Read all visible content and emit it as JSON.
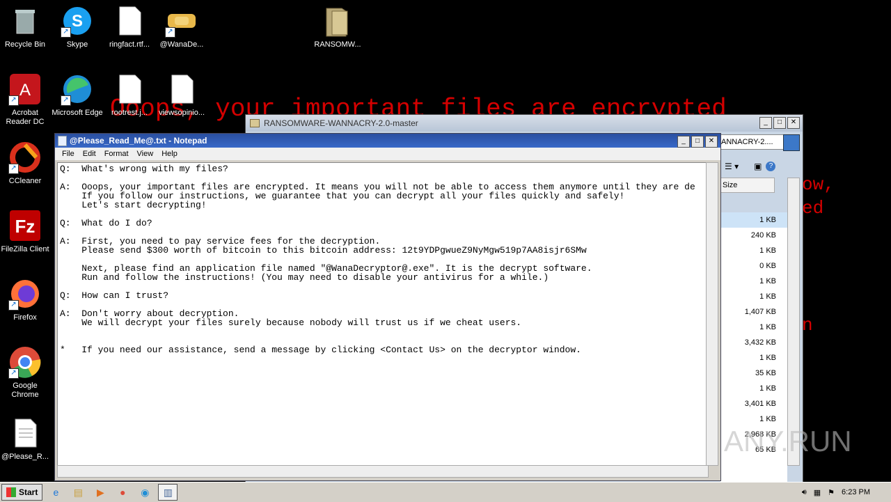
{
  "desktop": {
    "icons": [
      {
        "label": "Recycle Bin",
        "icon": "recycle-bin-icon"
      },
      {
        "label": "Skype",
        "icon": "skype-icon"
      },
      {
        "label": "ringfact.rtf...",
        "icon": "document-icon"
      },
      {
        "label": "@WanaDe...",
        "icon": "handshake-icon"
      },
      {
        "label": "RANSOMW...",
        "icon": "folder-icon"
      },
      {
        "label": "Acrobat Reader DC",
        "icon": "acrobat-icon"
      },
      {
        "label": "Microsoft Edge",
        "icon": "edge-icon"
      },
      {
        "label": "rootrest.j...",
        "icon": "document-icon"
      },
      {
        "label": "viewsopinio...",
        "icon": "document-icon"
      },
      {
        "label": "CCleaner",
        "icon": "ccleaner-icon"
      },
      {
        "label": "FileZilla Client",
        "icon": "filezilla-icon"
      },
      {
        "label": "Firefox",
        "icon": "firefox-icon"
      },
      {
        "label": "Google Chrome",
        "icon": "chrome-icon"
      },
      {
        "label": "@Please_R...",
        "icon": "text-file-icon"
      }
    ],
    "wallpaper_lines": [
      "Ooops, your important files are encrypted",
      "ow,",
      "ed",
      "n"
    ]
  },
  "explorer": {
    "title": "RANSOMWARE-WANNACRY-2.0-master",
    "address": "ANNACRY-2....",
    "column_header": "Size",
    "sizes": [
      "1 KB",
      "240 KB",
      "1 KB",
      "0 KB",
      "1 KB",
      "1 KB",
      "1,407 KB",
      "1 KB",
      "3,432 KB",
      "1 KB",
      "35 KB",
      "1 KB",
      "3,401 KB",
      "1 KB",
      "2,968 KB",
      "65 KB"
    ]
  },
  "notepad": {
    "title": "@Please_Read_Me@.txt - Notepad",
    "menu": [
      "File",
      "Edit",
      "Format",
      "View",
      "Help"
    ],
    "body": "Q:  What's wrong with my files?\n\nA:  Ooops, your important files are encrypted. It means you will not be able to access them anymore until they are de\n    If you follow our instructions, we guarantee that you can decrypt all your files quickly and safely!\n    Let's start decrypting!\n\nQ:  What do I do?\n\nA:  First, you need to pay service fees for the decryption.\n    Please send $300 worth of bitcoin to this bitcoin address: 12t9YDPgwueZ9NyMgw519p7AA8isjr6SMw\n\n    Next, please find an application file named \"@WanaDecryptor@.exe\". It is the decrypt software.\n    Run and follow the instructions! (You may need to disable your antivirus for a while.)\n\nQ:  How can I trust?\n\nA:  Don't worry about decryption.\n    We will decrypt your files surely because nobody will trust us if we cheat users.\n\n\n*   If you need our assistance, send a message by clicking <Contact Us> on the decryptor window."
  },
  "taskbar": {
    "start_label": "Start",
    "apps": [
      "ie-icon",
      "explorer-icon",
      "media-player-icon",
      "chrome-icon",
      "edge-icon",
      "notepad-icon"
    ],
    "clock": "6:23 PM"
  },
  "watermark": "ANY.RUN"
}
